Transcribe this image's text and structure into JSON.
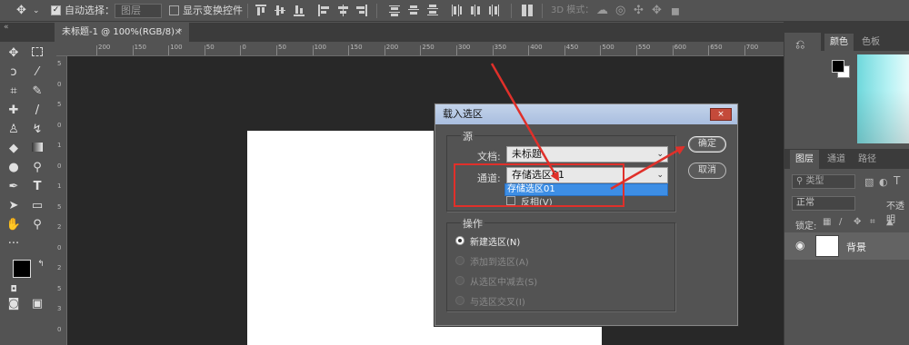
{
  "optionsbar": {
    "auto_select_label": "自动选择：",
    "auto_select_target": "图层",
    "show_transform_label": "显示变换控件",
    "mode_3d_label": "3D 模式："
  },
  "document_tab": {
    "title": "未标题-1 @ 100%(RGB/8) *",
    "close": "×"
  },
  "ruler": {
    "h_ticks": [
      "200",
      "150",
      "100",
      "50",
      "0",
      "50",
      "100",
      "150",
      "200",
      "250",
      "300",
      "350",
      "400",
      "450",
      "500",
      "550",
      "600",
      "650",
      "700"
    ],
    "v_ticks": [
      "5",
      "0",
      "5",
      "0",
      "1",
      "0",
      "1",
      "5",
      "2",
      "0",
      "2",
      "5",
      "3",
      "0"
    ]
  },
  "right_panel": {
    "color_tabs": [
      "颜色",
      "色板"
    ],
    "layer_tabs": [
      "图层",
      "通道",
      "路径"
    ],
    "search_placeholder": "类型",
    "blend_mode": "正常",
    "opacity_label": "不透明",
    "lock_label": "锁定:",
    "layer_name": "背景"
  },
  "dialog": {
    "title": "载入选区",
    "close_label": "×",
    "source_group": "源",
    "doc_label": "文档:",
    "doc_value": "未标题-",
    "channel_label": "通道:",
    "channel_value": "存储选区01",
    "channel_option": "存储选区01",
    "invert_label": "反相(V)",
    "operation_group": "操作",
    "ops": [
      "新建选区(N)",
      "添加到选区(A)",
      "从选区中减去(S)",
      "与选区交叉(I)"
    ],
    "ok_label": "确定",
    "cancel_label": "取消"
  },
  "colors": {
    "accent_highlight": "#3d8ee5",
    "annotation_red": "#e0302a"
  }
}
